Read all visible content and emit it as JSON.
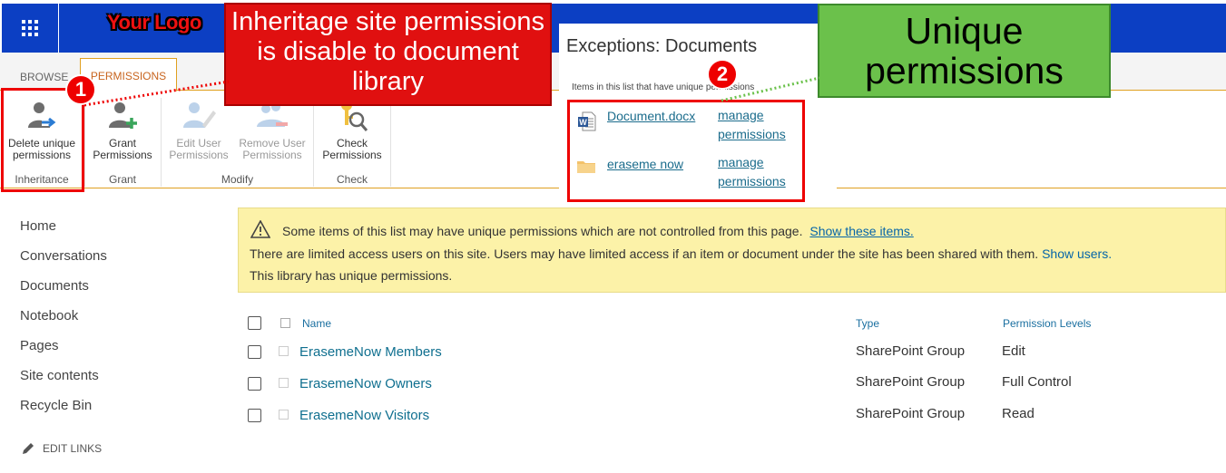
{
  "suitebar": {
    "logo_text": "Your Logo",
    "waffle_icon": "waffle-icon"
  },
  "ribbon": {
    "tabs": [
      {
        "label": "BROWSE"
      },
      {
        "label": "PERMISSIONS"
      }
    ],
    "buttons": {
      "delete_unique": "Delete unique permissions",
      "grant": "Grant Permissions",
      "edit_user": "Edit User Permissions",
      "remove_user": "Remove User Permissions",
      "check": "Check Permissions"
    },
    "groups": {
      "inheritance": "Inheritance",
      "grant": "Grant",
      "modify": "Modify",
      "check": "Check"
    }
  },
  "callouts": {
    "red": "Inheritage site permissions is disable to document library",
    "green": "Unique permissions",
    "badge1": "1",
    "badge2": "2"
  },
  "exceptions": {
    "title": "Exceptions: Documents",
    "subtitle": "Items in this list that have unique permissions",
    "items": [
      {
        "name": "Document.docx",
        "action": "manage permissions",
        "icon": "word-doc-icon"
      },
      {
        "name": "eraseme now",
        "action": "manage permissions",
        "icon": "folder-icon"
      }
    ]
  },
  "nav": {
    "items": [
      {
        "label": "Home"
      },
      {
        "label": "Conversations"
      },
      {
        "label": "Documents"
      },
      {
        "label": "Notebook"
      },
      {
        "label": "Pages"
      },
      {
        "label": "Site contents"
      },
      {
        "label": "Recycle Bin"
      }
    ],
    "edit_links": "EDIT LINKS"
  },
  "warning": {
    "line1": "Some items of this list may have unique permissions which are not controlled from this page.",
    "line1_link": "Show these items.",
    "line2": "There are limited access users on this site. Users may have limited access if an item or document under the site has been shared with them.",
    "line2_link": "Show users.",
    "line3": "This library has unique permissions."
  },
  "table": {
    "headers": {
      "name": "Name",
      "type": "Type",
      "levels": "Permission Levels"
    },
    "rows": [
      {
        "name": "ErasemeNow Members",
        "type": "SharePoint Group",
        "level": "Edit"
      },
      {
        "name": "ErasemeNow Owners",
        "type": "SharePoint Group",
        "level": "Full Control"
      },
      {
        "name": "ErasemeNow Visitors",
        "type": "SharePoint Group",
        "level": "Read"
      }
    ]
  },
  "colors": {
    "suite_blue": "#0c3fc3",
    "accent_orange": "#e0a020",
    "callout_red": "#e01010",
    "callout_green": "#6bc14b",
    "link": "#0f6f8f"
  }
}
